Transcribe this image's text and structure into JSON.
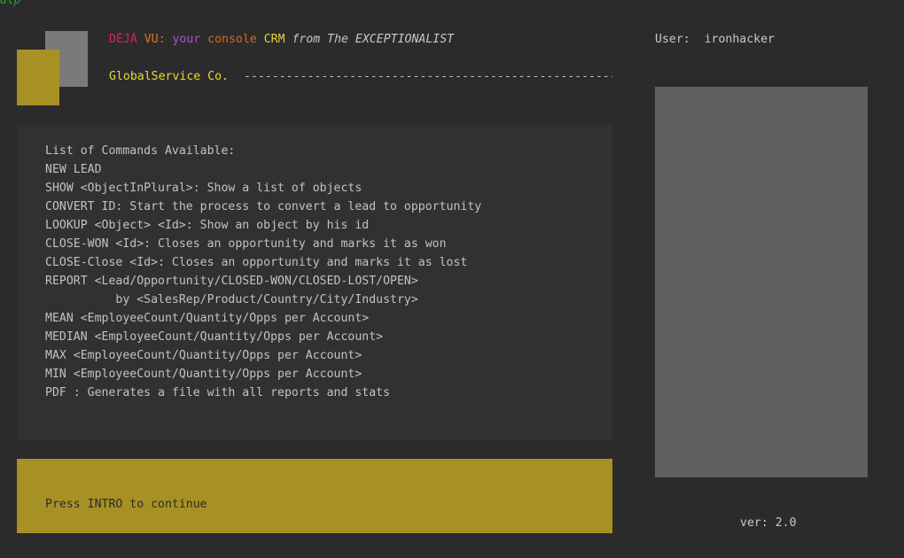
{
  "top_cut_text": "alp",
  "header": {
    "title_segments": [
      {
        "text": "DÉJÀ",
        "color": "#d2285a",
        "italic": false
      },
      {
        "text": " VU:",
        "color": "#d2782a",
        "italic": false
      },
      {
        "text": " your",
        "color": "#b04fd6",
        "italic": false
      },
      {
        "text": " console",
        "color": "#d26a2a",
        "italic": false
      },
      {
        "text": " CRM",
        "color": "#e2d23a",
        "italic": false
      },
      {
        "text": " from",
        "color": "#c8c8c8",
        "italic": true
      },
      {
        "text": " The EXCEPTIONALIST",
        "color": "#c8c8c8",
        "italic": true
      }
    ],
    "company": "GlobalService Co.",
    "divider": "-----------------------------------------------------",
    "user_label": "User:",
    "user_name": "ironhacker"
  },
  "commands": {
    "heading": "List of Commands Available:",
    "items": [
      "NEW LEAD",
      "SHOW <ObjectInPlural>: Show a list of objects",
      "CONVERT ID: Start the process to convert a lead to opportunity",
      "LOOKUP <Object> <Id>: Show an object by his id",
      "CLOSE-WON <Id>: Closes an opportunity and marks it as won",
      "CLOSE-Close <Id>: Closes an opportunity and marks it as lost",
      "REPORT <Lead/Opportunity/CLOSED-WON/CLOSED-LOST/OPEN>",
      "          by <SalesRep/Product/Country/City/Industry>",
      "MEAN <EmployeeCount/Quantity/Opps per Account>",
      "MEDIAN <EmployeeCount/Quantity/Opps per Account>",
      "MAX <EmployeeCount/Quantity/Opps per Account>",
      "MIN <EmployeeCount/Quantity/Opps per Account>",
      "PDF : Generates a file with all reports and stats"
    ]
  },
  "footer": {
    "prompt": "Press INTRO to continue"
  },
  "version": "ver: 2.0",
  "colors": {
    "background": "#2b2b2b",
    "panel": "#313131",
    "accent_gold": "#a79125",
    "side_panel": "#606060",
    "logo_gray": "#7a7a7a",
    "company_yellow": "#e6d93a"
  }
}
